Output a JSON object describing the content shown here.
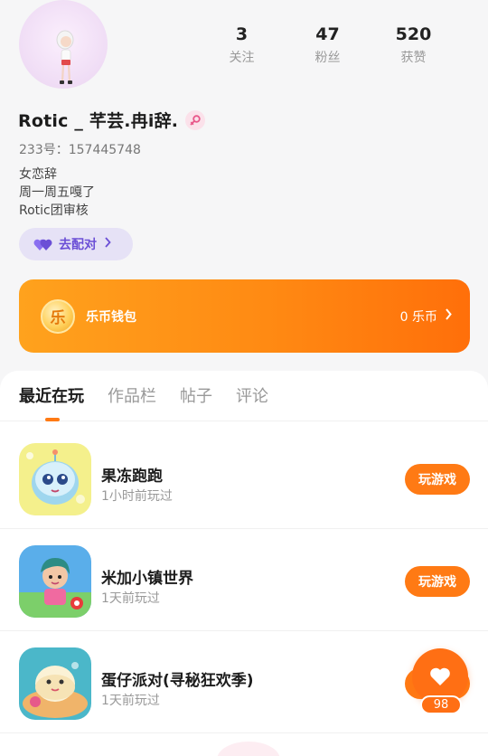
{
  "profile": {
    "username": "Rotic _ 芊芸.冉i辞.",
    "account_id": "233号：157445748",
    "bio_lines": [
      "女恋辞",
      "周一周五嘎了",
      "Rotic团审核"
    ],
    "match_label": "去配对"
  },
  "stats": [
    {
      "value": "3",
      "label": "关注"
    },
    {
      "value": "47",
      "label": "粉丝"
    },
    {
      "value": "520",
      "label": "获赞"
    }
  ],
  "wallet": {
    "coin_char": "乐",
    "title": "乐币钱包",
    "balance": "0 乐币"
  },
  "tabs": [
    {
      "label": "最近在玩",
      "active": true
    },
    {
      "label": "作品栏",
      "active": false
    },
    {
      "label": "帖子",
      "active": false
    },
    {
      "label": "评论",
      "active": false
    }
  ],
  "games": [
    {
      "name": "果冻跑跑",
      "time": "1小时前玩过",
      "button": "玩游戏"
    },
    {
      "name": "米加小镇世界",
      "time": "1天前玩过",
      "button": "玩游戏"
    },
    {
      "name": "蛋仔派对(寻秘狂欢季)",
      "time": "1天前玩过",
      "button": "玩游戏"
    }
  ],
  "like": {
    "count": "98"
  },
  "colors": {
    "accent": "#ff7a14",
    "match_purple": "#6b4fd6",
    "match_bg": "#e6e2f6"
  }
}
